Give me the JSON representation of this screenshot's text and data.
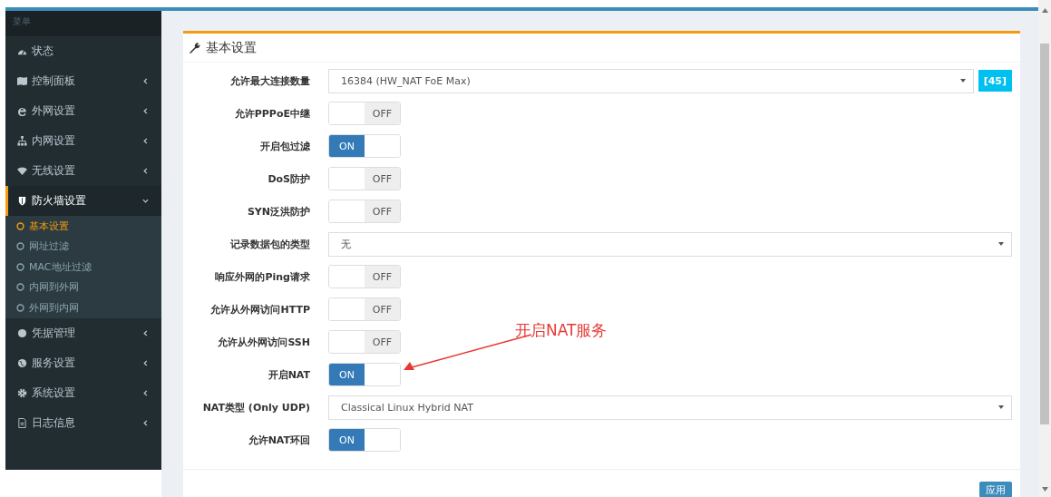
{
  "sidebar": {
    "header": "菜单",
    "items": [
      {
        "label": "状态",
        "kind": "link",
        "selected": false
      },
      {
        "label": "控制面板",
        "kind": "group",
        "expanded": false,
        "selected": false
      },
      {
        "label": "外网设置",
        "kind": "group",
        "expanded": false,
        "selected": false
      },
      {
        "label": "内网设置",
        "kind": "group",
        "expanded": false,
        "selected": false
      },
      {
        "label": "无线设置",
        "kind": "group",
        "expanded": false,
        "selected": false
      },
      {
        "label": "防火墙设置",
        "kind": "group",
        "expanded": true,
        "selected": true,
        "children": [
          {
            "label": "基本设置",
            "selected": true
          },
          {
            "label": "网址过滤",
            "selected": false
          },
          {
            "label": "MAC地址过滤",
            "selected": false
          },
          {
            "label": "内网到外网",
            "selected": false
          },
          {
            "label": "外网到内网",
            "selected": false
          }
        ]
      },
      {
        "label": "凭据管理",
        "kind": "group",
        "expanded": false,
        "selected": false
      },
      {
        "label": "服务设置",
        "kind": "group",
        "expanded": false,
        "selected": false
      },
      {
        "label": "系统设置",
        "kind": "group",
        "expanded": false,
        "selected": false
      },
      {
        "label": "日志信息",
        "kind": "group",
        "expanded": false,
        "selected": false
      }
    ]
  },
  "panel": {
    "title": "基本设置",
    "rows": [
      {
        "label": "允许最大连接数量",
        "kind": "select",
        "value": "16384 (HW_NAT FoE Max)",
        "badge": "[45]"
      },
      {
        "label": "允许PPPoE中继",
        "kind": "toggle",
        "on": false,
        "text": "OFF"
      },
      {
        "label": "开启包过滤",
        "kind": "toggle",
        "on": true,
        "text": "ON"
      },
      {
        "label": "DoS防护",
        "kind": "toggle",
        "on": false,
        "text": "OFF"
      },
      {
        "label": "SYN泛洪防护",
        "kind": "toggle",
        "on": false,
        "text": "OFF"
      },
      {
        "label": "记录数据包的类型",
        "kind": "select",
        "value": "无"
      },
      {
        "label": "响应外网的Ping请求",
        "kind": "toggle",
        "on": false,
        "text": "OFF"
      },
      {
        "label": "允许从外网访问HTTP",
        "kind": "toggle",
        "on": false,
        "text": "OFF"
      },
      {
        "label": "允许从外网访问SSH",
        "kind": "toggle",
        "on": false,
        "text": "OFF"
      },
      {
        "label": "开启NAT",
        "kind": "toggle",
        "on": true,
        "text": "ON"
      },
      {
        "label": "NAT类型 (Only UDP)",
        "kind": "select",
        "value": "Classical Linux Hybrid NAT"
      },
      {
        "label": "允许NAT环回",
        "kind": "toggle",
        "on": true,
        "text": "ON"
      }
    ],
    "apply_button": "应用"
  },
  "annotation": {
    "text": "开启NAT服务"
  }
}
